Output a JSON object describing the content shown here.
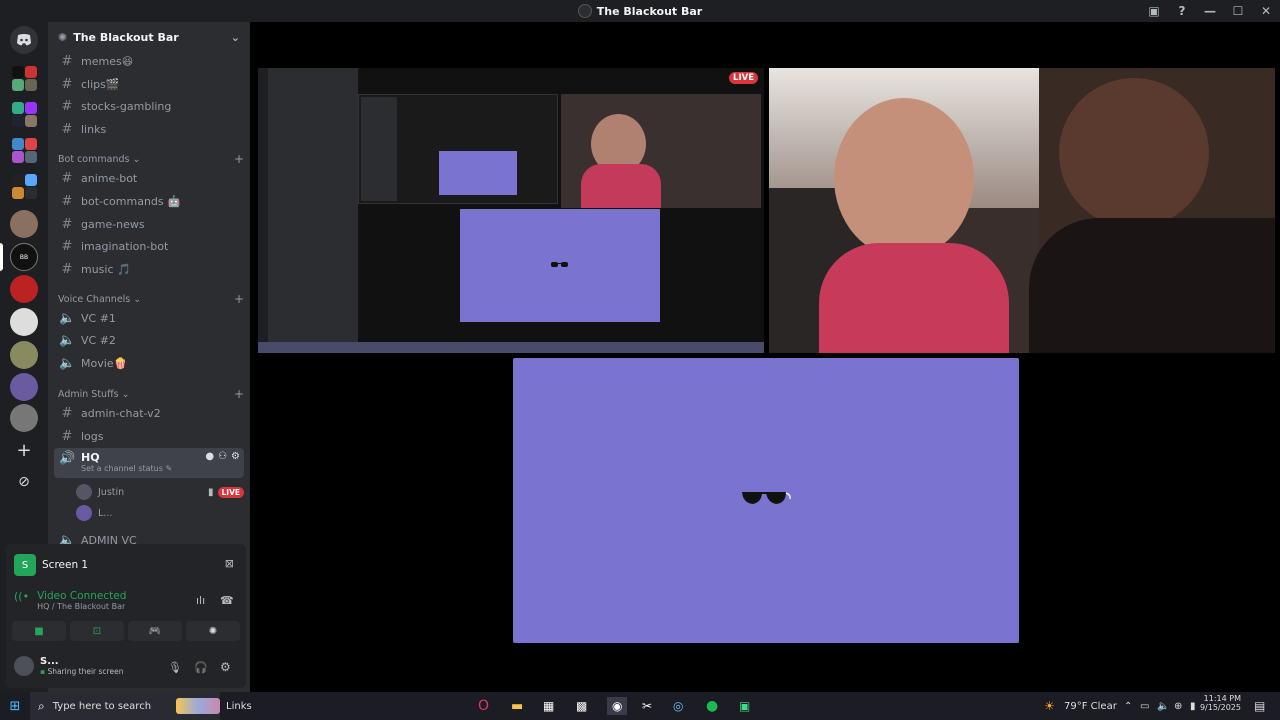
{
  "window": {
    "title": "The Blackout Bar"
  },
  "server": {
    "name": "The Blackout Bar"
  },
  "channels_top": [
    {
      "label": "memes😆"
    },
    {
      "label": "clips🎬"
    },
    {
      "label": "stocks-gambling"
    },
    {
      "label": "links"
    }
  ],
  "categories": {
    "bot": "Bot commands",
    "voice": "Voice Channels",
    "admin": "Admin Stuffs"
  },
  "bot_channels": [
    {
      "label": "anime-bot"
    },
    {
      "label": "bot-commands 🤖"
    },
    {
      "label": "game-news"
    },
    {
      "label": "imagination-bot"
    },
    {
      "label": "music 🎵"
    }
  ],
  "voice_channels": [
    {
      "label": "VC #1"
    },
    {
      "label": "VC #2"
    },
    {
      "label": "Movie🍿"
    }
  ],
  "admin_channels": [
    {
      "label": "admin-chat-v2"
    },
    {
      "label": "logs"
    }
  ],
  "hq": {
    "label": "HQ",
    "status_hint": "Set a channel status",
    "users": [
      {
        "name": "Justin",
        "badge": "LIVE"
      },
      {
        "name": "L..."
      }
    ]
  },
  "admin_vc": {
    "label": "ADMIN VC"
  },
  "screen_panel": {
    "title": "Screen 1"
  },
  "voice_status": {
    "title": "Video Connected",
    "subtitle": "HQ / The Blackout Bar"
  },
  "user": {
    "name": "S...",
    "status": "Sharing their screen"
  },
  "stream": {
    "live_badge": "LIVE"
  },
  "taskbar": {
    "search_placeholder": "Type here to search",
    "links_label": "Links",
    "weather": "79°F  Clear",
    "time": "11:14 PM",
    "date": "9/15/2025"
  },
  "colors": {
    "blurple": "#7b73d0",
    "green": "#23a55a",
    "live": "#da373c"
  }
}
